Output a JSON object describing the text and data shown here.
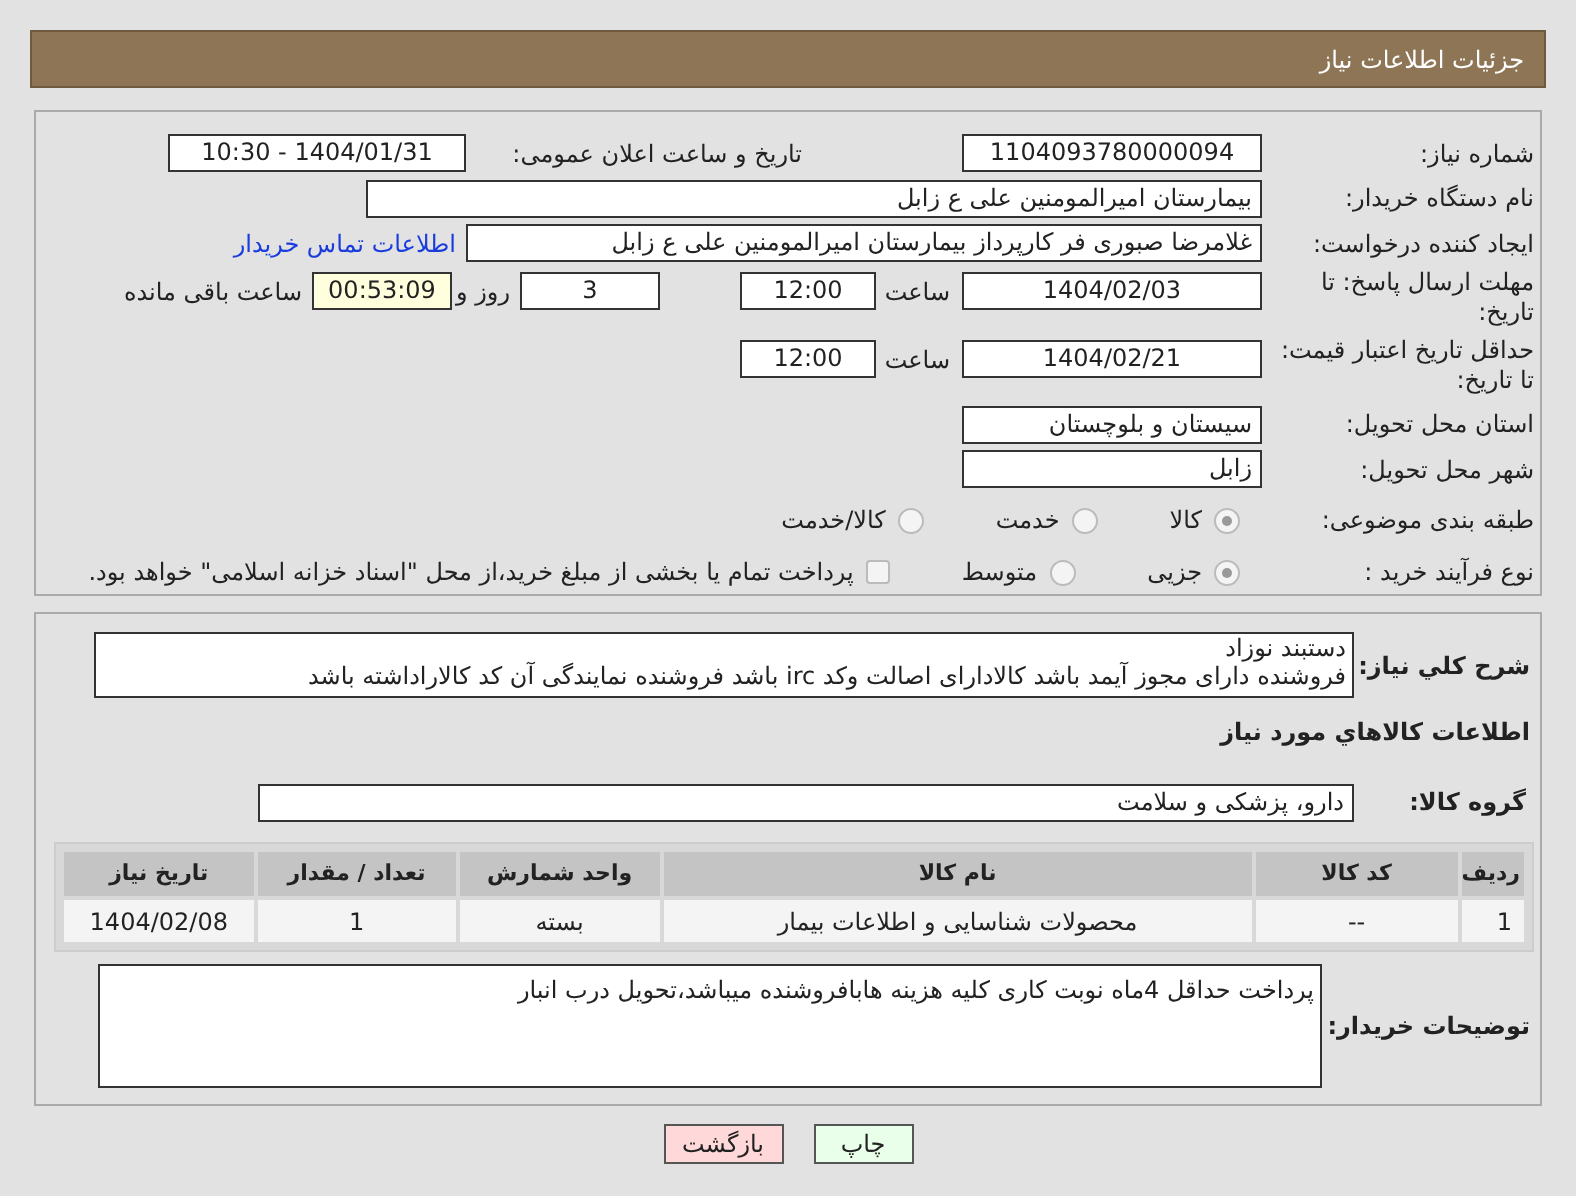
{
  "header": {
    "title": "جزئیات اطلاعات نیاز"
  },
  "need_number": {
    "label": "شماره نیاز:",
    "value": "1104093780000094"
  },
  "announce": {
    "label": "تاریخ و ساعت اعلان عمومی:",
    "value": "1404/01/31 - 10:30"
  },
  "buyer_org": {
    "label": "نام دستگاه خریدار:",
    "value": "بیمارستان امیرالمومنین علی  ع  زابل"
  },
  "requester": {
    "label": "ایجاد کننده درخواست:",
    "value": "غلامرضا صبوری فر کارپرداز بیمارستان امیرالمومنین علی  ع  زابل",
    "link": "اطلاعات تماس خریدار"
  },
  "deadline": {
    "label": "مهلت ارسال پاسخ: تا تاریخ:",
    "date": "1404/02/03",
    "time_label": "ساعت",
    "time": "12:00",
    "days": "3",
    "days_label": "روز و",
    "remaining": "00:53:09",
    "remaining_label": "ساعت باقی مانده"
  },
  "price_validity": {
    "label": "حداقل تاریخ اعتبار قیمت: تا تاریخ:",
    "date": "1404/02/21",
    "time_label": "ساعت",
    "time": "12:00"
  },
  "province": {
    "label": "استان محل تحویل:",
    "value": "سیستان و بلوچستان"
  },
  "city": {
    "label": "شهر محل تحویل:",
    "value": "زابل"
  },
  "category": {
    "label": "طبقه بندی موضوعی:",
    "options": [
      {
        "label": "کالا",
        "selected": true
      },
      {
        "label": "خدمت",
        "selected": false
      },
      {
        "label": "کالا/خدمت",
        "selected": false
      }
    ]
  },
  "process": {
    "label": "نوع فرآیند خرید :",
    "options": [
      {
        "label": "جزیی",
        "selected": true
      },
      {
        "label": "متوسط",
        "selected": false
      }
    ],
    "payment": {
      "checked": false,
      "text": "پرداخت تمام یا بخشی از مبلغ خرید،از محل \"اسناد خزانه اسلامی\" خواهد بود."
    }
  },
  "description": {
    "label": "شرح کلي نیاز:",
    "lines": [
      "دستبند نوزاد",
      "فروشنده دارای مجوز آیمد باشد کالادارای اصالت وکد irc باشد فروشنده نمایندگی آن کد کالاراداشته باشد"
    ]
  },
  "items_heading": "اطلاعات کالاهاي مورد نیاز",
  "goods_group": {
    "label": "گروه کالا:",
    "value": "دارو، پزشکی و سلامت"
  },
  "table": {
    "columns": [
      "ردیف",
      "کد کالا",
      "نام کالا",
      "واحد شمارش",
      "تعداد / مقدار",
      "تاریخ نیاز"
    ],
    "rows": [
      [
        "1",
        "--",
        "محصولات شناسایی و اطلاعات بیمار",
        "بسته",
        "1",
        "1404/02/08"
      ]
    ]
  },
  "notes": {
    "label": "توضیحات خریدار:",
    "value": "پرداخت حداقل 4ماه نوبت کاری کلیه هزینه هابافروشنده میباشد،تحویل درب انبار"
  },
  "buttons": [
    {
      "label": "چاپ",
      "kind": "print"
    },
    {
      "label": "بازگشت",
      "kind": "back"
    }
  ]
}
